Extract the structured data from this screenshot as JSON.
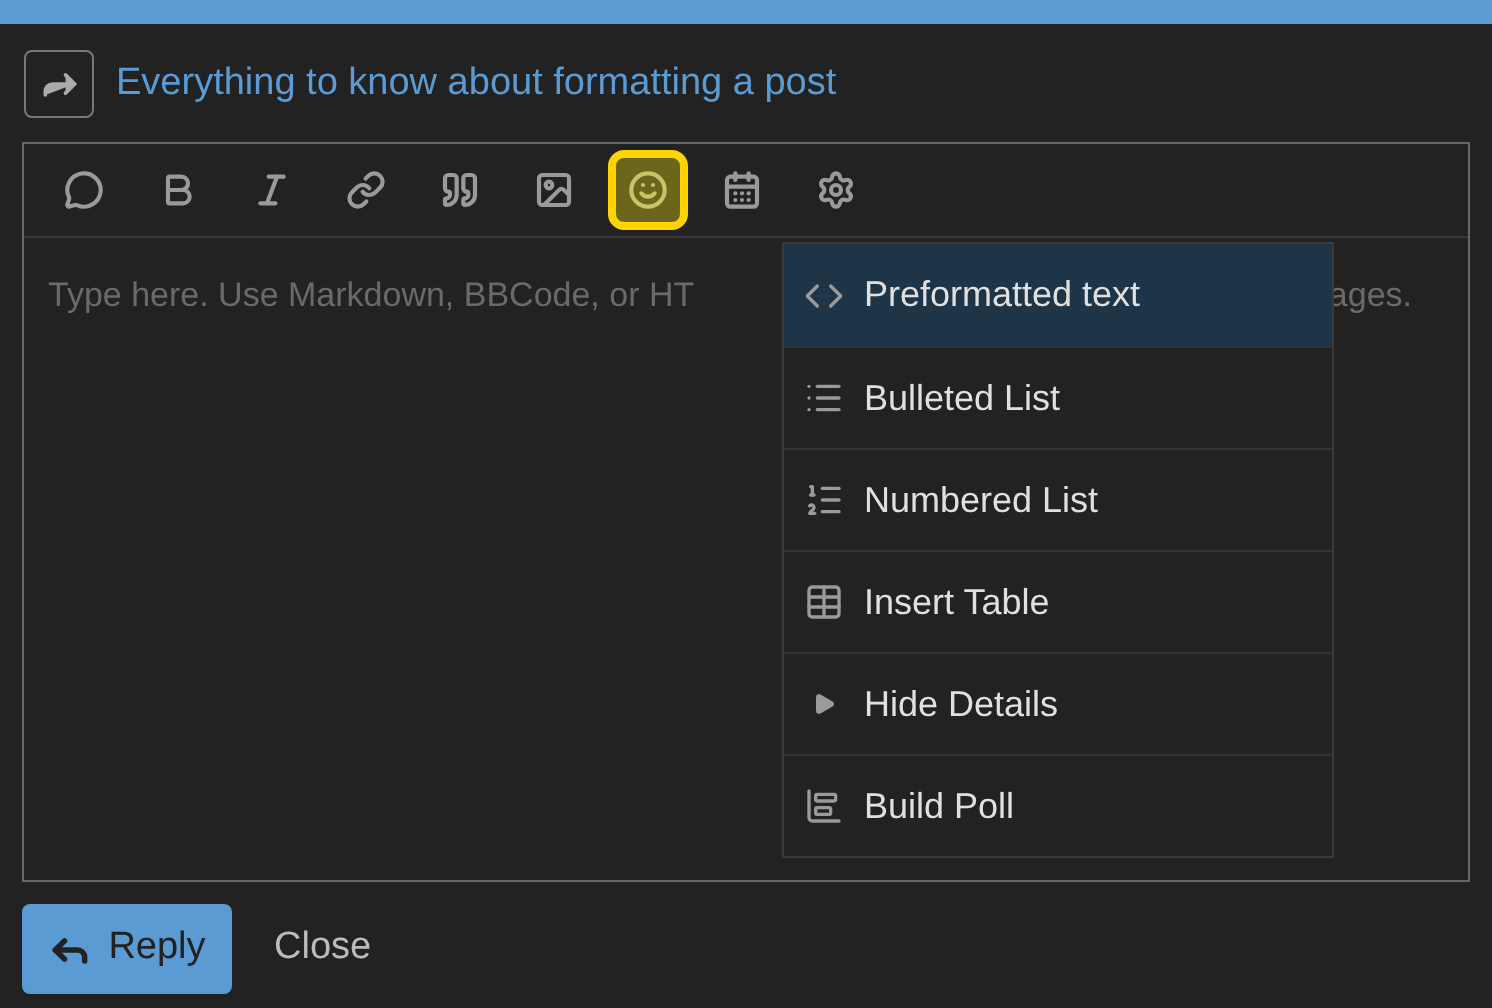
{
  "header": {
    "title": "Everything to know about formatting a post"
  },
  "toolbar": [
    {
      "selected": false
    },
    {
      "selected": false
    },
    {
      "selected": false
    },
    {
      "selected": false
    },
    {
      "selected": false
    },
    {
      "selected": false
    },
    {
      "selected": true
    },
    {
      "selected": false
    },
    {
      "selected": false
    }
  ],
  "editor": {
    "placeholder_start": "Type here. Use Markdown, BBCode, or HT",
    "placeholder_end": "ages."
  },
  "menu": [
    {
      "label": "Preformatted text",
      "selected": true
    },
    {
      "label": "Bulleted List",
      "selected": false
    },
    {
      "label": "Numbered List",
      "selected": false
    },
    {
      "label": "Insert Table",
      "selected": false
    },
    {
      "label": "Hide Details",
      "selected": false
    },
    {
      "label": "Build Poll",
      "selected": false
    }
  ],
  "buttons": {
    "reply": "Reply",
    "close": "Close"
  }
}
